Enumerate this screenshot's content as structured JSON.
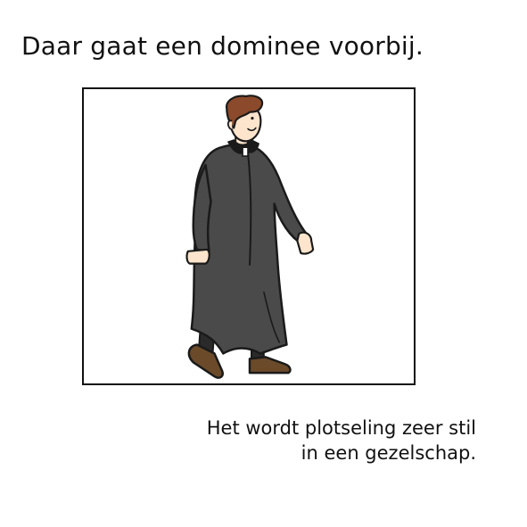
{
  "title": "Daar gaat een dominee voorbij.",
  "illustration": {
    "icon": "walking-minister-illustration",
    "colors": {
      "robe": "#4a4a4a",
      "hair": "#8b4a2b",
      "skin": "#fde4cc",
      "shoes": "#6b4a2a",
      "collar": "#ffffff",
      "outline": "#1a1a1a"
    }
  },
  "caption": {
    "line1": "Het wordt plotseling zeer stil",
    "line2": "in een gezelschap."
  }
}
